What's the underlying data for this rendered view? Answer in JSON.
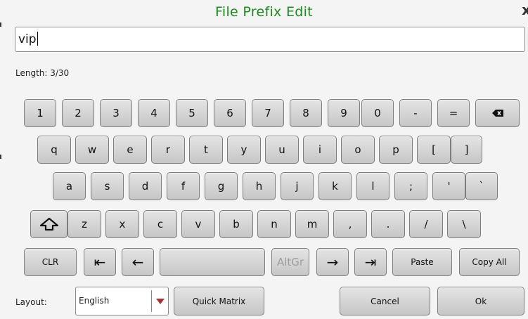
{
  "dialog": {
    "title": "File Prefix Edit",
    "close_glyph": "x"
  },
  "input": {
    "value": "vip"
  },
  "length": {
    "text": "Length: 3/30"
  },
  "keys": {
    "row1": [
      "1",
      "2",
      "3",
      "4",
      "5",
      "6",
      "7",
      "8",
      "9",
      "0",
      "-",
      "="
    ],
    "row2": [
      "q",
      "w",
      "e",
      "r",
      "t",
      "y",
      "u",
      "i",
      "o",
      "p",
      "[",
      "]"
    ],
    "row3": [
      "a",
      "s",
      "d",
      "f",
      "g",
      "h",
      "j",
      "k",
      "l",
      ";",
      "'",
      "`"
    ],
    "row4": [
      "z",
      "x",
      "c",
      "v",
      "b",
      "n",
      "m",
      ",",
      ".",
      "/",
      "\\"
    ],
    "row5": {
      "clear": "CLR",
      "home": "⇤",
      "left": "←",
      "altgr": "AltGr",
      "right": "→",
      "end": "⇥",
      "paste": "Paste",
      "copy_all": "Copy All"
    },
    "icons": {
      "backspace": "backspace-icon",
      "shift": "shift-icon"
    }
  },
  "footer": {
    "layout_label": "Layout:",
    "layout_value": "English",
    "quick_matrix": "Quick Matrix",
    "cancel": "Cancel",
    "ok": "Ok"
  },
  "colors": {
    "title": "#1c8a1c",
    "background": "#f4f4f4",
    "key_top": "#e4e4e4",
    "key_bottom": "#c6c6c6"
  }
}
